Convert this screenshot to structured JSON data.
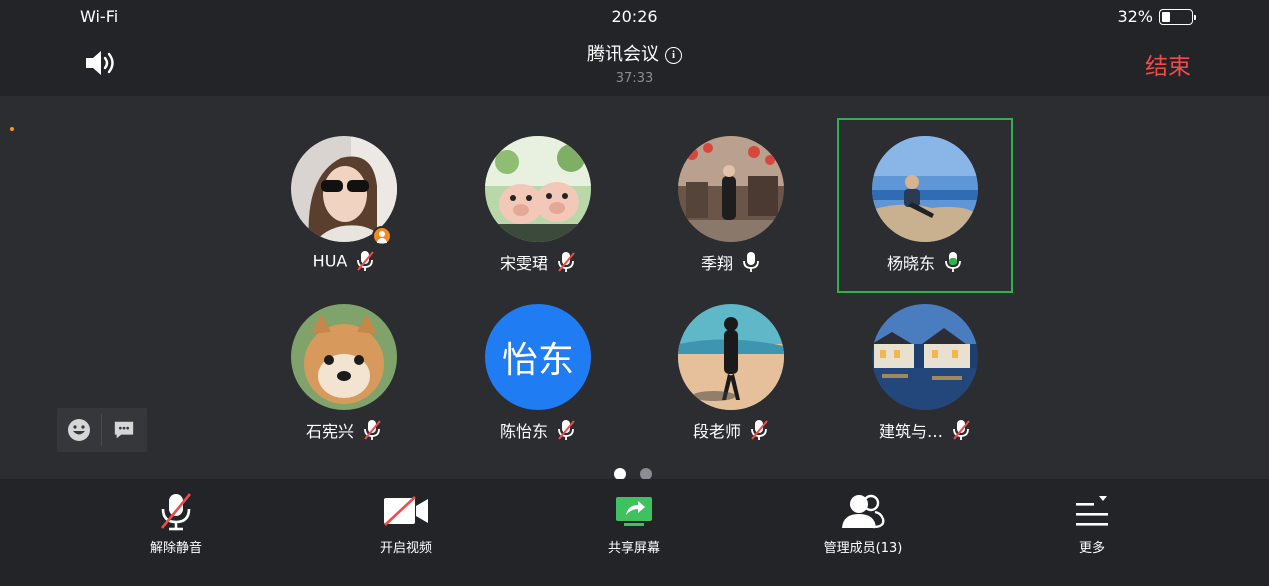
{
  "status_bar": {
    "network": "Wi-Fi",
    "time": "20:26",
    "battery": "32%",
    "battery_level": 0.32
  },
  "header": {
    "title": "腾讯会议",
    "duration": "37:33",
    "end_label": "结束",
    "speaker_icon": "speaker-icon",
    "info_icon": "info-icon"
  },
  "participants": [
    {
      "name": "HUA",
      "mic": "muted",
      "host": true,
      "avatar": "woman-sunglasses-photo"
    },
    {
      "name": "宋雯珺",
      "mic": "muted",
      "avatar": "pig-figurines-photo"
    },
    {
      "name": "季翔",
      "mic": "on",
      "avatar": "woman-lantern-street-photo"
    },
    {
      "name": "杨晓东",
      "mic": "active",
      "active": true,
      "avatar": "man-seaside-photo"
    },
    {
      "name": "石宪兴",
      "mic": "muted",
      "avatar": "shiba-dog-photo"
    },
    {
      "name": "陈怡东",
      "mic": "muted",
      "avatar_text": "怡东"
    },
    {
      "name": "段老师",
      "mic": "muted",
      "avatar": "woman-beach-photo"
    },
    {
      "name": "建筑与…",
      "mic": "muted",
      "avatar": "water-town-night-photo"
    }
  ],
  "chat_tools": {
    "emoji_icon": "emoji-icon",
    "message_icon": "chat-icon"
  },
  "pager": {
    "pages": 2,
    "current": 1
  },
  "toolbar": {
    "unmute": "解除静音",
    "video": "开启视频",
    "share": "共享屏幕",
    "members": "管理成员(13)",
    "more": "更多"
  },
  "colors": {
    "end": "#f24a4a",
    "accent_green": "#31b14d",
    "host_badge": "#f58a1f",
    "text_avatar": "#1f7cf2"
  }
}
